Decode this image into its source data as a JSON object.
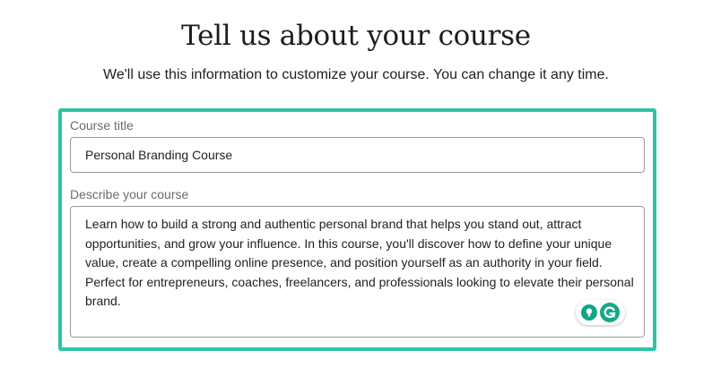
{
  "header": {
    "title": "Tell us about your course",
    "subtitle": "We'll use this information to customize your course. You can change it any time."
  },
  "form": {
    "course_title": {
      "label": "Course title",
      "value": "Personal Branding Course"
    },
    "course_description": {
      "label": "Describe your course",
      "value": "Learn how to build a strong and authentic personal brand that helps you stand out, attract opportunities, and grow your influence. In this course, you'll discover how to define your unique value, create a compelling online presence, and position yourself as an authority in your field. Perfect for entrepreneurs, coaches, freelancers, and professionals looking to elevate their personal brand."
    }
  },
  "grammarly": {
    "icons": [
      "lightbulb-icon",
      "grammarly-logo-icon"
    ],
    "color": "#15a887"
  },
  "colors": {
    "panel_border": "#2ec4a6",
    "input_border": "#9a9a9a",
    "label_text": "#6b6b6b"
  }
}
